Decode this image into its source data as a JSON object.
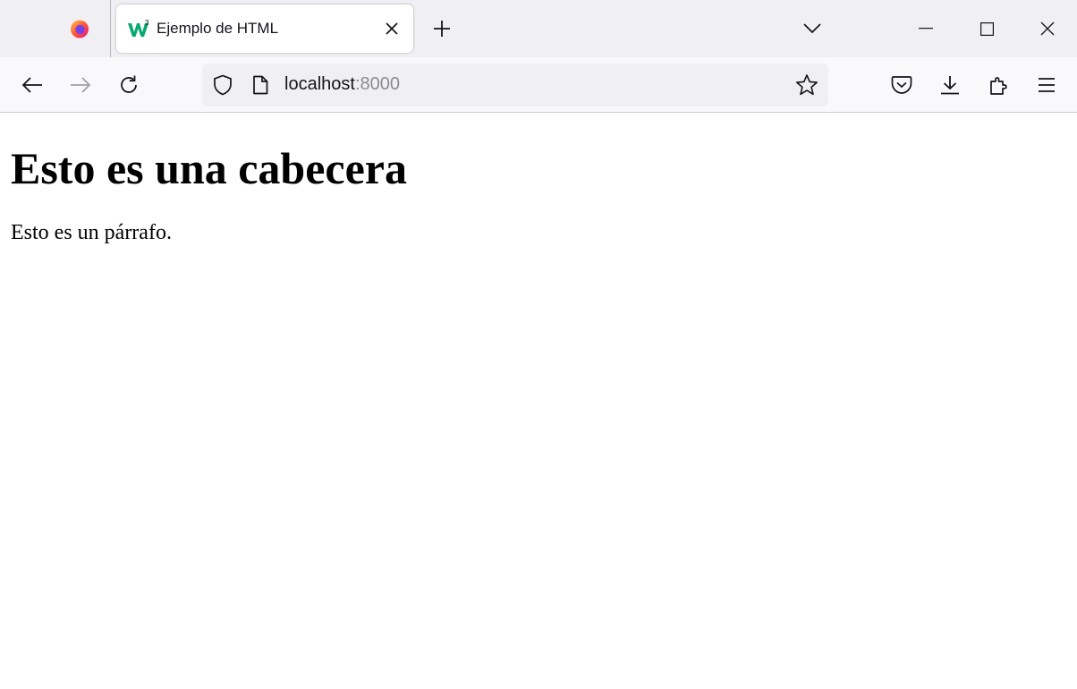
{
  "browser": {
    "tab": {
      "title": "Ejemplo de HTML",
      "favicon": "w3schools-icon"
    },
    "icons": {
      "firefox": "firefox-icon",
      "tab_close": "close-icon",
      "new_tab": "plus-icon",
      "tab_list": "chevron-down-icon",
      "minimize": "minimize-icon",
      "maximize": "maximize-icon",
      "close_window": "close-icon",
      "back": "arrow-left-icon",
      "forward": "arrow-right-icon",
      "reload": "reload-icon",
      "tracking_protection": "shield-icon",
      "page_info": "page-icon",
      "bookmark": "star-icon",
      "pocket": "pocket-icon",
      "downloads": "download-icon",
      "extensions": "puzzle-icon",
      "menu": "hamburger-menu-icon"
    },
    "url": {
      "host": "localhost",
      "port": ":8000"
    },
    "state": {
      "forward_enabled": false
    }
  },
  "page": {
    "heading": "Esto es una cabecera",
    "paragraph": "Esto es un párrafo."
  },
  "colors": {
    "tabstrip_bg": "#f0f0f4",
    "navbar_bg": "#f9f9fb",
    "urlbar_bg": "#f0f0f4",
    "icon": "#15141a",
    "icon_disabled": "#a0a0a8",
    "favicon_green": "#04aa6d"
  }
}
